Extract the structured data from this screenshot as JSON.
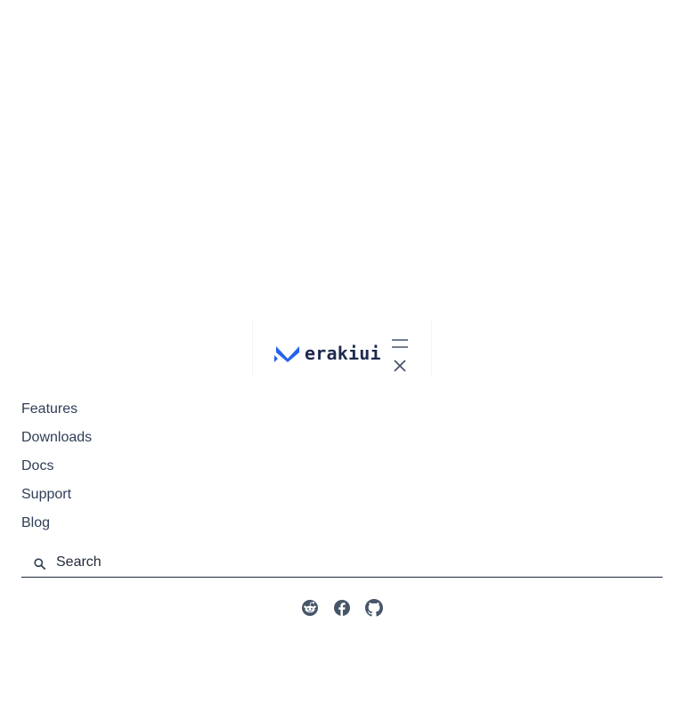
{
  "brand": {
    "logo_text": "erakiui",
    "logo_mark_color": "#2563eb",
    "text_color": "#1e2a4f"
  },
  "menu": {
    "toggle_icons": [
      "hamburger-icon",
      "close-icon"
    ]
  },
  "nav": {
    "items": [
      {
        "label": "Features"
      },
      {
        "label": "Downloads"
      },
      {
        "label": "Docs"
      },
      {
        "label": "Support"
      },
      {
        "label": "Blog"
      }
    ]
  },
  "search": {
    "placeholder": "Search",
    "value": "",
    "icon": "search-icon"
  },
  "social": {
    "icons": [
      "reddit-icon",
      "facebook-icon",
      "github-icon"
    ],
    "icon_color": "#475569"
  }
}
